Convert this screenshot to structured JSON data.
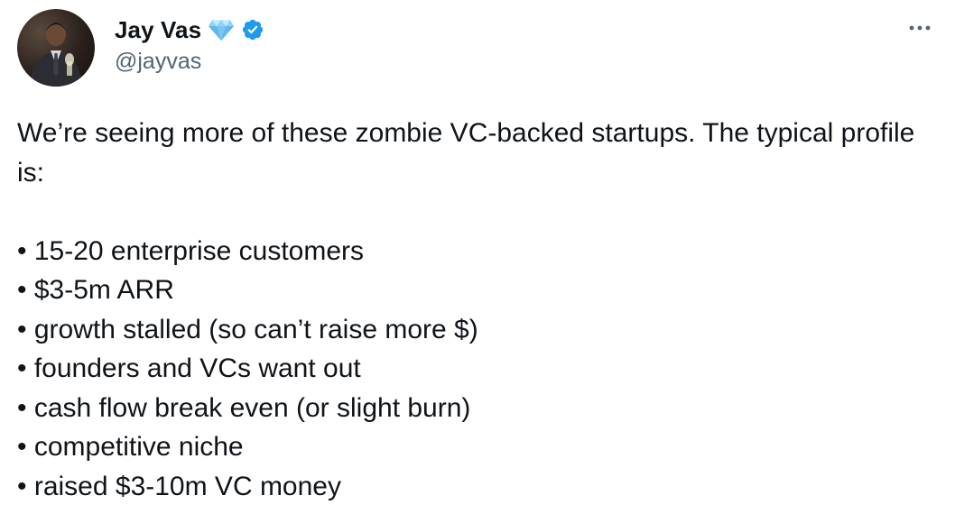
{
  "tweet": {
    "author": {
      "display_name": "Jay Vas",
      "handle": "@jayvas",
      "badge_emoji": "gem-icon",
      "verified": "verified-badge-icon"
    },
    "menu_icon": "more-horizontal-icon",
    "text_intro": "We’re seeing more of these zombie VC-backed startups. The typical profile is:",
    "bullets": [
      "• 15-20 enterprise customers",
      "• $3-5m ARR",
      "• growth stalled (so can’t raise more $)",
      "• founders and VCs want out",
      "• cash flow break even (or slight burn)",
      "• competitive niche",
      "• raised $3-10m VC money"
    ]
  },
  "colors": {
    "text_primary": "#0f1419",
    "text_secondary": "#536471",
    "verified_blue": "#1d9bf0",
    "gem_blue": "#7cc7f2"
  }
}
